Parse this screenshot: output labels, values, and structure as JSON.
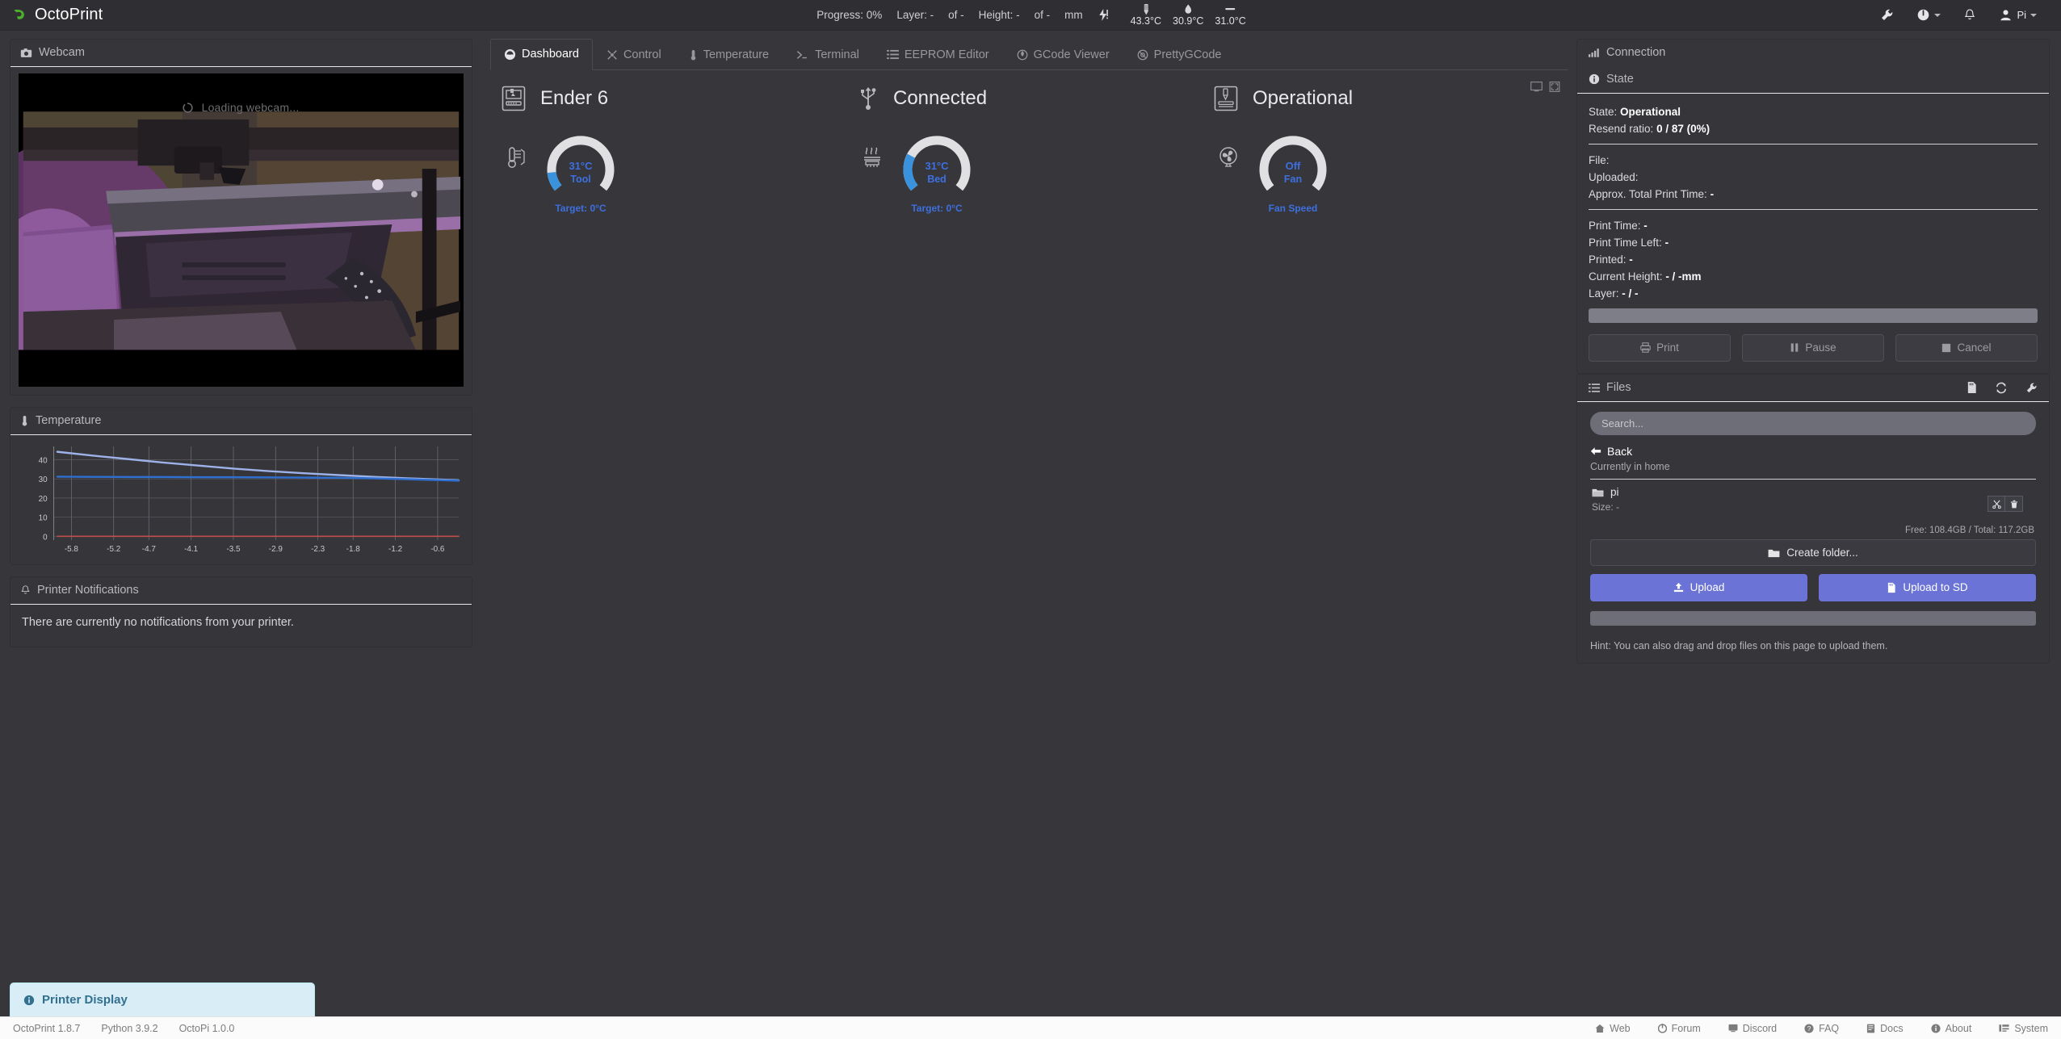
{
  "app": {
    "brand": "OctoPrint",
    "brand_color": "#4caf2b"
  },
  "topbar": {
    "progress_label": "Progress: 0%",
    "layer_label": "Layer: -",
    "layer_of": "of -",
    "height_label": "Height: -",
    "height_of": "of -",
    "unit": "mm",
    "temps": [
      {
        "icon": "tool-temp-icon",
        "value": "43.3°C"
      },
      {
        "icon": "bed-temp-icon",
        "value": "30.9°C"
      },
      {
        "icon": "chamber-temp-icon",
        "value": "31.0°C"
      }
    ],
    "flash_icon": "resend-flash-icon",
    "actions": [
      {
        "name": "settings-wrench-button",
        "icon": "wrench-icon"
      },
      {
        "name": "power-button",
        "icon": "power-icon",
        "caret": true
      },
      {
        "name": "notifications-button",
        "icon": "bell-icon"
      }
    ],
    "user": "Pi"
  },
  "tabs": [
    {
      "label": "Dashboard",
      "icon": "gauge-icon",
      "active": true
    },
    {
      "label": "Control",
      "icon": "crosshair-icon",
      "active": false
    },
    {
      "label": "Temperature",
      "icon": "thermometer-icon",
      "active": false
    },
    {
      "label": "Terminal",
      "icon": "terminal-icon",
      "active": false
    },
    {
      "label": "EEPROM Editor",
      "icon": "list-icon",
      "active": false
    },
    {
      "label": "GCode Viewer",
      "icon": "target-icon",
      "active": false
    },
    {
      "label": "PrettyGCode",
      "icon": "circle-target-icon",
      "active": false
    }
  ],
  "dashboard": {
    "cards": [
      {
        "icon": "printer-icon",
        "label": "Ender 6"
      },
      {
        "icon": "usb-icon",
        "label": "Connected"
      },
      {
        "icon": "printer-state-icon",
        "label": "Operational"
      }
    ],
    "corner_icons": [
      {
        "name": "screen-icon"
      },
      {
        "name": "fullscreen-icon"
      }
    ],
    "gauges": [
      {
        "icon": "tool-thermometer-icon",
        "value": "31°C",
        "key": "Tool",
        "sub": "Target: 0°C",
        "percent": 13,
        "fill_color": "#3a92dd",
        "track_color": "#e0e0e2"
      },
      {
        "icon": "bed-heat-icon",
        "value": "31°C",
        "key": "Bed",
        "sub": "Target: 0°C",
        "percent": 26,
        "fill_color": "#3a92dd",
        "track_color": "#e0e0e2"
      },
      {
        "icon": "fan-icon",
        "value": "Off",
        "key": "Fan",
        "sub": "Fan Speed",
        "percent": 0,
        "fill_color": "#3a92dd",
        "track_color": "#e0e0e2"
      }
    ]
  },
  "webcam": {
    "title": "Webcam",
    "icon": "camera-icon",
    "loading_text": "Loading webcam..."
  },
  "temperature_panel": {
    "title": "Temperature",
    "icon": "thermometer-icon"
  },
  "chart_data": {
    "type": "line",
    "title": "Temperature",
    "xlabel": "",
    "ylabel": "",
    "xlim": [
      -6.05,
      -0.3
    ],
    "ylim": [
      -2,
      47
    ],
    "yticks": [
      0,
      10,
      20,
      30,
      40
    ],
    "xticks": [
      -5.8,
      -5.2,
      -4.7,
      -4.1,
      -3.5,
      -2.9,
      -2.3,
      -1.8,
      -1.2,
      -0.6
    ],
    "grid": true,
    "legend": "none",
    "series": [
      {
        "name": "Bed actual",
        "color": "#9db2e8",
        "x": [
          -6.0,
          -5.5,
          -5.0,
          -4.5,
          -4.0,
          -3.5,
          -3.0,
          -2.5,
          -2.0,
          -1.5,
          -1.0,
          -0.5,
          -0.3
        ],
        "values": [
          44.2,
          42.2,
          40.4,
          38.6,
          37.0,
          35.4,
          34.1,
          33.0,
          32.0,
          31.1,
          30.3,
          29.6,
          29.3
        ]
      },
      {
        "name": "Tool actual",
        "color": "#2f6fd0",
        "x": [
          -6.0,
          -5.5,
          -5.0,
          -4.5,
          -4.0,
          -3.5,
          -3.0,
          -2.5,
          -2.0,
          -1.5,
          -1.0,
          -0.5,
          -0.3
        ],
        "values": [
          31.2,
          31.1,
          31.0,
          31.0,
          30.9,
          30.9,
          30.8,
          30.7,
          30.6,
          30.3,
          29.8,
          29.3,
          29.1
        ]
      },
      {
        "name": "Target",
        "color": "#c0504d",
        "x": [
          -6.0,
          -0.3
        ],
        "values": [
          0,
          0
        ]
      }
    ]
  },
  "notifications": {
    "title": "Printer Notifications",
    "icon": "bell-icon",
    "empty_text": "There are currently no notifications from your printer."
  },
  "connection": {
    "title": "Connection",
    "icon": "signal-icon"
  },
  "state": {
    "title": "State",
    "icon": "info-icon",
    "state_key": "State:",
    "state_value": "Operational",
    "resend_key": "Resend ratio:",
    "resend_value": "0 / 87 (0%)",
    "file_key": "File:",
    "file_value": "",
    "uploaded_key": "Uploaded:",
    "uploaded_value": "",
    "approx_key": "Approx. Total Print Time:",
    "approx_value": "-",
    "print_time_key": "Print Time:",
    "print_time_value": "-",
    "print_time_left_key": "Print Time Left:",
    "print_time_left_value": "-",
    "printed_key": "Printed:",
    "printed_value": "-",
    "current_height_key": "Current Height:",
    "current_height_value": "- / -mm",
    "layer_key": "Layer:",
    "layer_value": "- / -",
    "buttons": [
      {
        "label": "Print",
        "icon": "print-icon"
      },
      {
        "label": "Pause",
        "icon": "pause-icon"
      },
      {
        "label": "Cancel",
        "icon": "stop-icon"
      }
    ]
  },
  "files": {
    "title": "Files",
    "icon": "files-list-icon",
    "actions": [
      {
        "name": "sd-card-button",
        "icon": "sd-card-icon"
      },
      {
        "name": "refresh-button",
        "icon": "refresh-icon"
      },
      {
        "name": "files-settings-button",
        "icon": "wrench-icon"
      }
    ],
    "search_placeholder": "Search...",
    "search_value": "",
    "back_label": "Back",
    "current_dir": "Currently in home",
    "rows": [
      {
        "name": "pi",
        "icon": "folder-icon",
        "size_label": "Size: -",
        "actions": [
          {
            "name": "cut-button",
            "glyph": "✂"
          },
          {
            "name": "delete-button",
            "glyph": "🗑"
          }
        ]
      }
    ],
    "free_label": "Free: 108.4GB / Total: 117.2GB",
    "create_folder_label": "Create folder...",
    "upload_label": "Upload",
    "upload_sd_label": "Upload to SD",
    "hint": "Hint: You can also drag and drop files on this page to upload them."
  },
  "printer_display": {
    "label": "Printer Display",
    "icon": "info-icon"
  },
  "footer": {
    "versions": [
      "OctoPrint 1.8.7",
      "Python 3.9.2",
      "OctoPi 1.0.0"
    ],
    "links": [
      {
        "label": "Web",
        "icon": "home-icon"
      },
      {
        "label": "Forum",
        "icon": "forum-icon"
      },
      {
        "label": "Discord",
        "icon": "discord-icon"
      },
      {
        "label": "FAQ",
        "icon": "question-icon"
      },
      {
        "label": "Docs",
        "icon": "book-icon"
      },
      {
        "label": "About",
        "icon": "info-icon"
      },
      {
        "label": "System",
        "icon": "system-icon"
      }
    ]
  }
}
